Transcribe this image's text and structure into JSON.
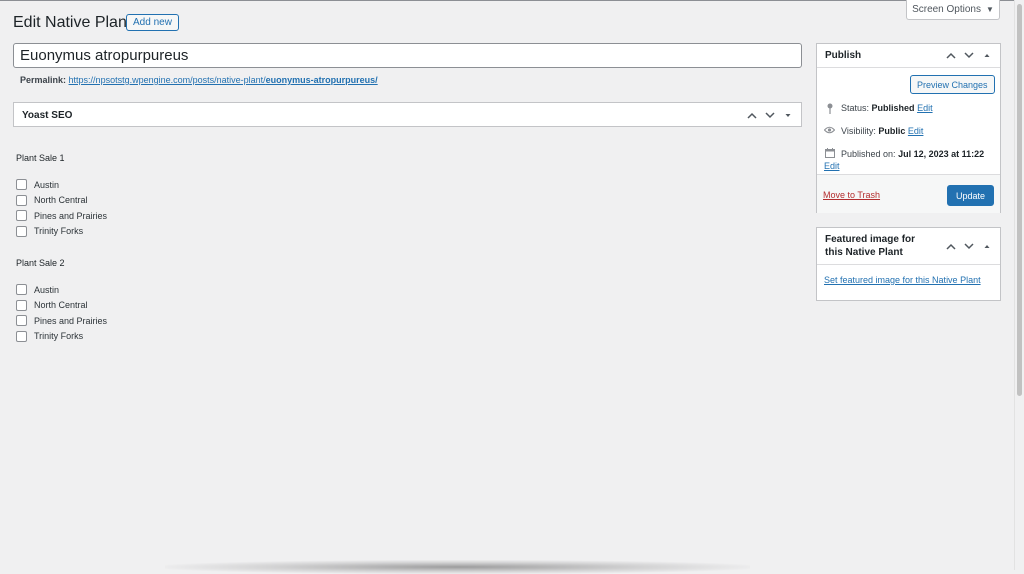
{
  "header": {
    "screen_options": "Screen Options",
    "page_title": "Edit Native Plant",
    "add_new": "Add new"
  },
  "editor": {
    "post_title": "Euonymus atropurpureus",
    "permalink_label": "Permalink:",
    "permalink_base": "https://npsotstg.wpengine.com/posts/native-plant/",
    "permalink_slug": "euonymus-atropurpureus/"
  },
  "yoast": {
    "title": "Yoast SEO"
  },
  "plant_sales": [
    {
      "title": "Plant Sale 1",
      "options": [
        "Austin",
        "North Central",
        "Pines and Prairies",
        "Trinity Forks"
      ]
    },
    {
      "title": "Plant Sale 2",
      "options": [
        "Austin",
        "North Central",
        "Pines and Prairies",
        "Trinity Forks"
      ]
    }
  ],
  "publish": {
    "title": "Publish",
    "preview_changes": "Preview Changes",
    "status_label": "Status:",
    "status_value": "Published",
    "visibility_label": "Visibility:",
    "visibility_value": "Public",
    "published_on_label": "Published on:",
    "published_on_value": "Jul 12, 2023 at 11:22",
    "edit": "Edit",
    "move_to_trash": "Move to Trash",
    "update": "Update"
  },
  "featured_image": {
    "title": "Featured image for this Native Plant",
    "link": "Set featured image for this Native Plant"
  },
  "colors": {
    "accent": "#2271b1",
    "danger": "#b32d2e",
    "background": "#f0f0f1"
  }
}
